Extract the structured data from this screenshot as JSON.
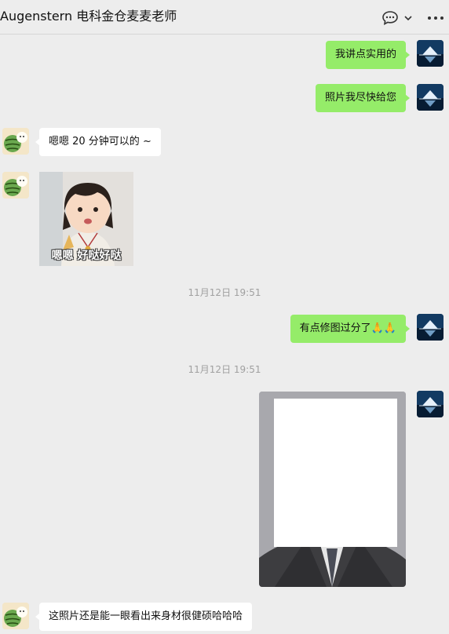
{
  "header": {
    "title": "Augenstern  电科金仓麦麦老师",
    "icons": [
      "chat-bubble-icon",
      "chevron-down-icon",
      "more-icon"
    ]
  },
  "messages": [
    {
      "side": "out",
      "type": "text",
      "text": "我讲点实用的"
    },
    {
      "side": "out",
      "type": "text",
      "text": "照片我尽快给您"
    },
    {
      "side": "in",
      "type": "text",
      "text": "嗯嗯 20 分钟可以的 ~"
    },
    {
      "side": "in",
      "type": "sticker",
      "caption": "嗯嗯 好哒好哒"
    },
    {
      "type": "timestamp",
      "text": "11月12日 19:51"
    },
    {
      "side": "out",
      "type": "text",
      "text": "有点修图过分了🙏🙏"
    },
    {
      "type": "timestamp",
      "text": "11月12日 19:51"
    },
    {
      "side": "out",
      "type": "image",
      "description": "photo"
    },
    {
      "side": "in",
      "type": "text",
      "text": "这照片还是能一眼看出来身材很健硕哈哈哈"
    }
  ],
  "colors": {
    "background": "#ededed",
    "outgoing_bubble": "#95ec69",
    "incoming_bubble": "#ffffff",
    "timestamp": "#a0a0a0"
  }
}
